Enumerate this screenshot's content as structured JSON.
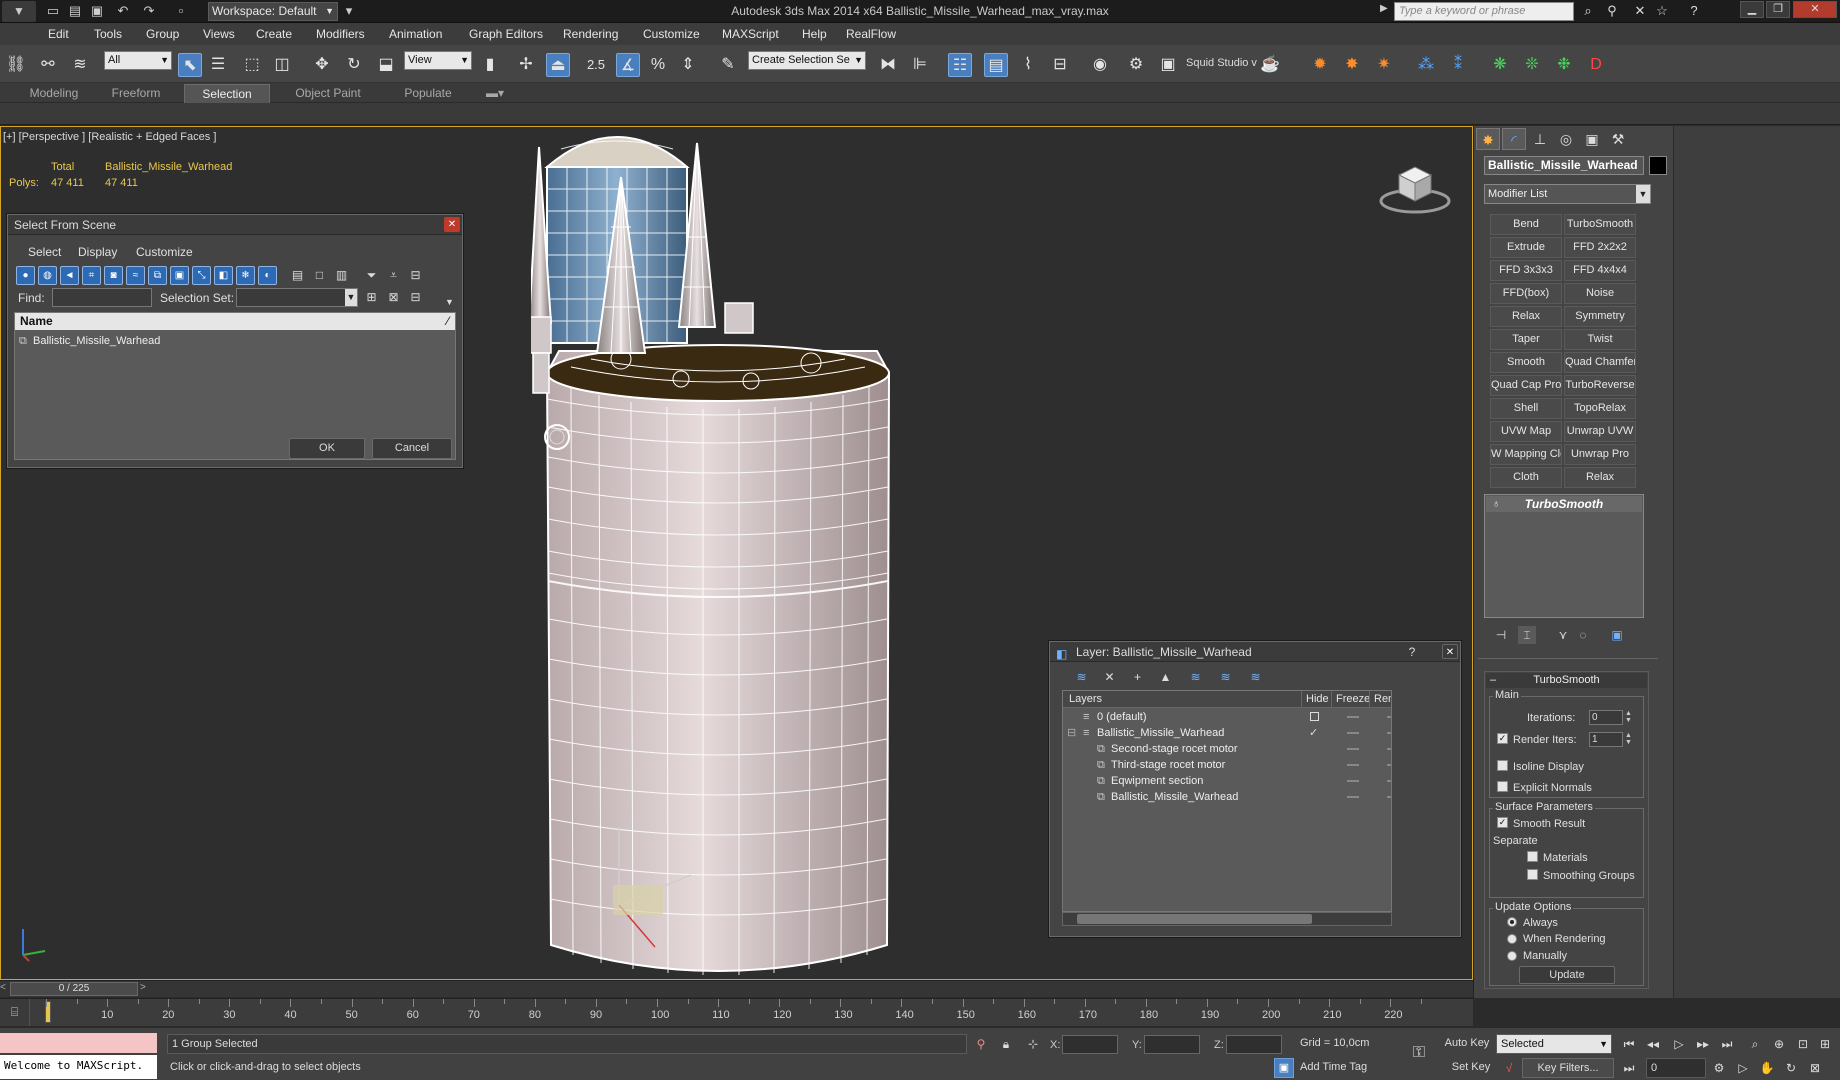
{
  "titlebar": {
    "workspace": "Workspace: Default",
    "title": "Autodesk 3ds Max 2014 x64      Ballistic_Missile_Warhead_max_vray.max",
    "search_placeholder": "Type a keyword or phrase"
  },
  "menu": [
    "Edit",
    "Tools",
    "Group",
    "Views",
    "Create",
    "Modifiers",
    "Animation",
    "Graph Editors",
    "Rendering",
    "Customize",
    "MAXScript",
    "Help",
    "RealFlow"
  ],
  "toolbar": {
    "selection_filter": "All",
    "ref_coord": "View",
    "snap_value": "2.5",
    "named_selection": "Create Selection Se",
    "squid_label": "Squid Studio v"
  },
  "ribbon_tabs": [
    "Modeling",
    "Freeform",
    "Selection",
    "Object Paint",
    "Populate"
  ],
  "viewport": {
    "label": "[+] [Perspective ] [Realistic + Edged Faces ]",
    "stats": {
      "col_total": "Total",
      "col_object": "Ballistic_Missile_Warhead",
      "row_label": "Polys:",
      "total": "47 411",
      "object": "47 411"
    }
  },
  "select_dialog": {
    "title": "Select From Scene",
    "menu": [
      "Select",
      "Display",
      "Customize"
    ],
    "find_label": "Find:",
    "selset_label": "Selection Set:",
    "col_name": "Name",
    "items": [
      "Ballistic_Missile_Warhead"
    ],
    "ok": "OK",
    "cancel": "Cancel"
  },
  "layer_dialog": {
    "title": "Layer: Ballistic_Missile_Warhead",
    "help": "?",
    "columns": [
      "Layers",
      "Hide",
      "Freeze",
      "Rende"
    ],
    "rows": [
      {
        "name": "0 (default)"
      },
      {
        "name": "Ballistic_Missile_Warhead"
      },
      {
        "name": "Second-stage rocet motor"
      },
      {
        "name": "Third-stage rocet motor"
      },
      {
        "name": "Eqwipment section"
      },
      {
        "name": "Ballistic_Missile_Warhead"
      }
    ]
  },
  "command_panel": {
    "object_name": "Ballistic_Missile_Warhead",
    "object_color": "#000000",
    "modifier_list": "Modifier List",
    "modifier_buttons": [
      "Bend",
      "TurboSmooth",
      "Extrude",
      "FFD 2x2x2",
      "FFD 3x3x3",
      "FFD 4x4x4",
      "FFD(box)",
      "Noise",
      "Relax",
      "Symmetry",
      "Taper",
      "Twist",
      "Smooth",
      "Quad Chamfer",
      "Quad Cap Pro",
      "TurboReverse",
      "Shell",
      "TopoRelax",
      "UVW Map",
      "Unwrap UVW",
      "W Mapping Cle",
      "Unwrap Pro",
      "Cloth",
      "Relax"
    ],
    "stack_item": "TurboSmooth",
    "rollout": {
      "title": "TurboSmooth",
      "main": "Main",
      "iterations_label": "Iterations:",
      "iterations": "0",
      "render_iters_label": "Render Iters:",
      "render_iters": "1",
      "isoline": "Isoline Display",
      "explicit": "Explicit Normals",
      "surface": "Surface Parameters",
      "smooth_result": "Smooth Result",
      "separate": "Separate",
      "materials": "Materials",
      "smoothing_groups": "Smoothing Groups",
      "update_options": "Update Options",
      "always": "Always",
      "when_rendering": "When Rendering",
      "manually": "Manually",
      "update": "Update"
    }
  },
  "timeline": {
    "frame": "0 / 225",
    "ticks": [
      "10",
      "20",
      "30",
      "40",
      "50",
      "60",
      "70",
      "80",
      "90",
      "100",
      "110",
      "120",
      "130",
      "140",
      "150",
      "160",
      "170",
      "180",
      "190",
      "200",
      "210",
      "220"
    ]
  },
  "status": {
    "maxscript": "Welcome to MAXScript.",
    "selection": "1 Group Selected",
    "prompt": "Click or click-and-drag to select objects",
    "x_label": "X:",
    "y_label": "Y:",
    "z_label": "Z:",
    "grid": "Grid = 10,0cm",
    "add_time_tag": "Add Time Tag",
    "auto_key": "Auto Key",
    "set_key": "Set Key",
    "key_mode": "Selected",
    "key_filters": "Key Filters...",
    "frame_field": "0"
  },
  "colors": {
    "active_border": "#d4a425",
    "accent_blue": "#4a7fbf",
    "stats_yellow": "#e8c84a"
  }
}
